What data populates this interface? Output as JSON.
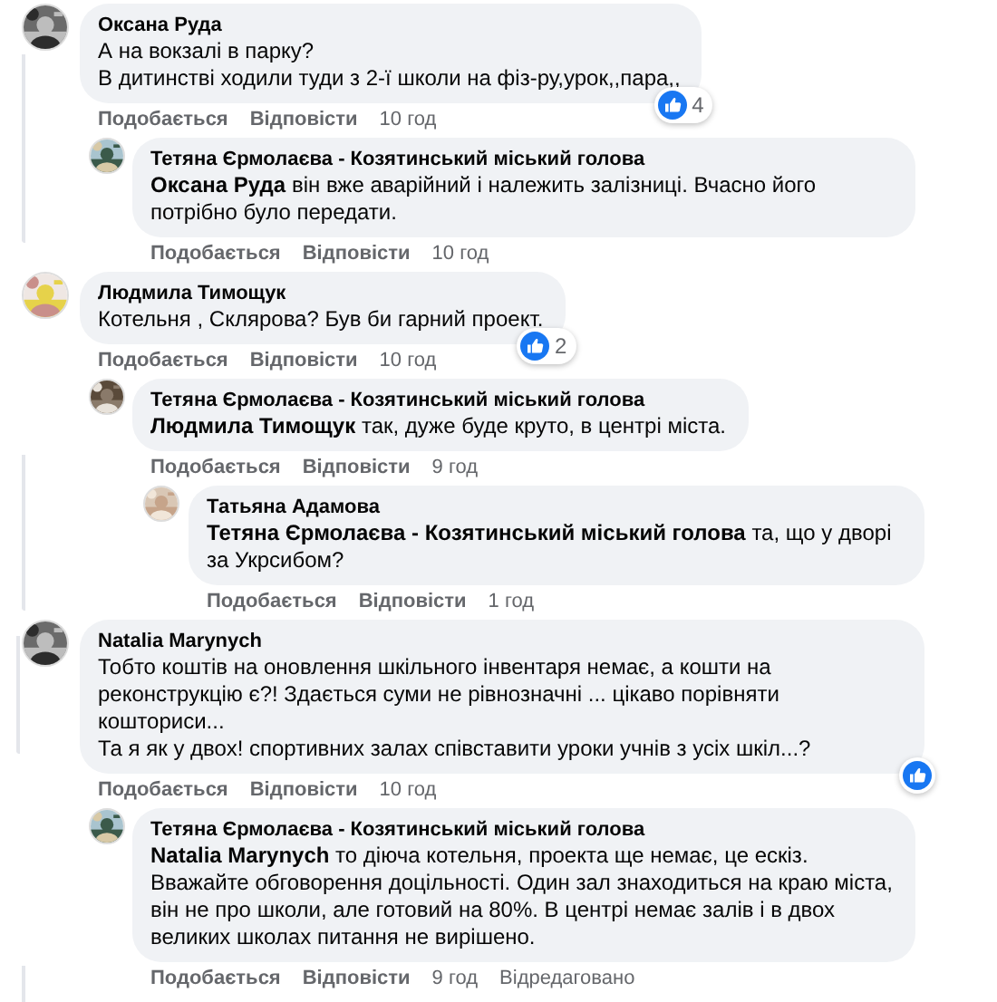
{
  "comments": [
    {
      "author": "Оксана Руда",
      "text": "А на вокзалі в парку?\nВ дитинстві ходили туди з 2-ї школи на фіз-ру,урок,,пара,,",
      "like_label": "Подобається",
      "reply_label": "Відповісти",
      "time": "10 год",
      "reacted": true,
      "reaction_count": "4",
      "replies": [
        {
          "author": "Тетяна Єрмолаєва - Козятинський міський голова",
          "text": "**Оксана Руда** він вже аварійний і належить залізниці. Вчасно його потрібно було передати.",
          "like_label": "Подобається",
          "reply_label": "Відповісти",
          "time": "10 год"
        }
      ]
    },
    {
      "author": "Людмила Тимощук",
      "text": "Котельня , Склярова? Був би гарний проект.",
      "like_label": "Подобається",
      "reply_label": "Відповісти",
      "time": "10 год",
      "reacted": true,
      "reaction_count": "2",
      "replies": [
        {
          "author": "Тетяна Єрмолаєва - Козятинський міський голова",
          "text": "**Людмила Тимощук** так, дуже буде круто, в центрі міста.",
          "like_label": "Подобається",
          "reply_label": "Відповісти",
          "time": "9 год",
          "replies": [
            {
              "author": "Татьяна Адамова",
              "text": "**Тетяна Єрмолаєва - Козятинський міський голова** та, що у дворі за Укрсибом?",
              "like_label": "Подобається",
              "reply_label": "Відповісти",
              "time": "1 год"
            }
          ]
        }
      ]
    },
    {
      "author": "Natalia Marynych",
      "text": "Тобто коштів на оновлення шкільного інвентаря немає, а кошти на реконструкцію є?! Здається суми не рівнозначні ... цікаво порівняти кошториси...\nТа я як у двох! спортивних залах співставити уроки учнів з усіх шкіл...?",
      "like_label": "Подобається",
      "reply_label": "Відповісти",
      "time": "10 год",
      "reacted": true,
      "replies": [
        {
          "author": "Тетяна Єрмолаєва - Козятинський міський голова",
          "text": "**Natalia Marynych** то діюча котельня, проекта ще немає, це ескіз. Вважайте обговорення доцільності. Один зал знаходиться на краю міста, він не про школи, але готовий на 80%. В центрі немає залів і в двох великих школах питання не вирішено.",
          "like_label": "Подобається",
          "reply_label": "Відповісти",
          "time": "9 год",
          "edited_label": "Відредаговано"
        }
      ]
    }
  ]
}
